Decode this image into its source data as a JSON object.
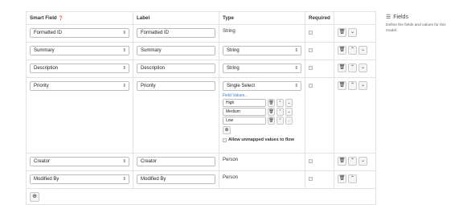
{
  "headers": {
    "smart_field": "Smart Field",
    "smart_field_icon": "help-icon",
    "label": "Label",
    "type": "Type",
    "required": "Required"
  },
  "rows": [
    {
      "smart_field": "Formatted ID",
      "label": "Formatted ID",
      "type": "String",
      "type_editable": false
    },
    {
      "smart_field": "Summary",
      "label": "Summary",
      "type": "String",
      "type_editable": true
    },
    {
      "smart_field": "Description",
      "label": "Description",
      "type": "String",
      "type_editable": true
    },
    {
      "smart_field": "Priority",
      "label": "Priority",
      "type": "Single Select",
      "type_editable": true
    },
    {
      "smart_field": "Creator",
      "label": "Creator",
      "type": "Person",
      "type_editable": false
    },
    {
      "smart_field": "Modified By",
      "label": "Modified By",
      "type": "Person",
      "type_editable": false
    }
  ],
  "field_values": {
    "link": "Field Values...",
    "values": [
      "High",
      "Medium",
      "Low"
    ],
    "allow_unmapped": "Allow unmapped values to flow"
  },
  "sidebar": {
    "icon": "list-icon",
    "title": "Fields",
    "description": "Define the fields and values for this model."
  },
  "icons": {
    "delete": "trash-icon",
    "up": "chevron-up-icon",
    "down": "chevron-down-icon",
    "add": "plus-icon",
    "select_arrow": "select-arrow-icon"
  }
}
